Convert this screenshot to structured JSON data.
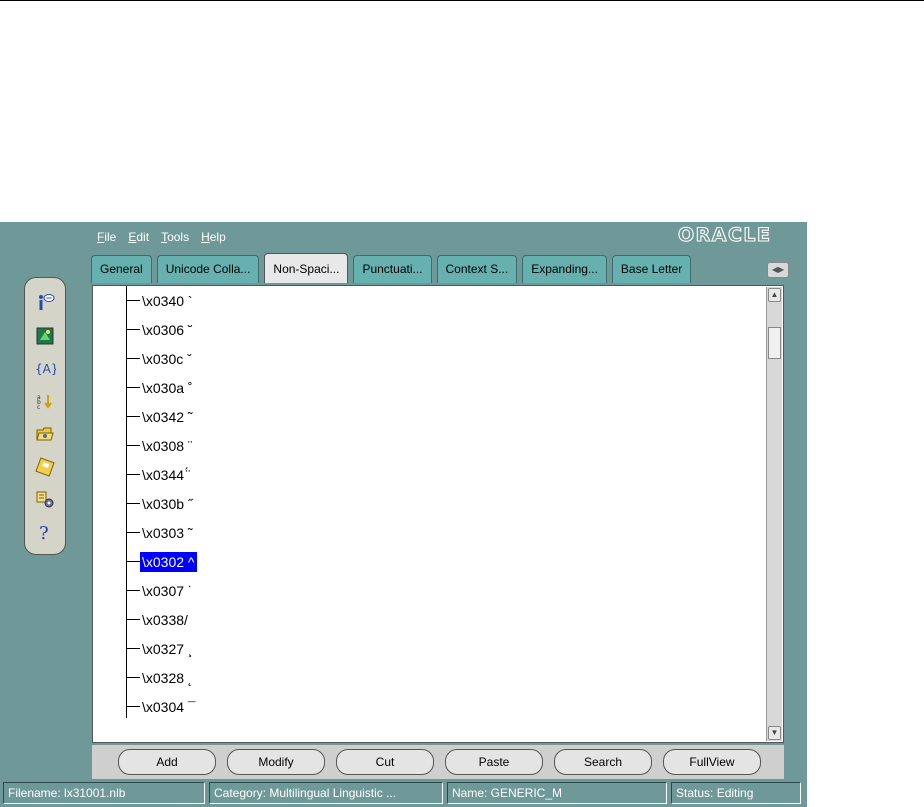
{
  "menu": {
    "file": {
      "accel": "F",
      "rest": "ile"
    },
    "edit": {
      "accel": "E",
      "rest": "dit"
    },
    "tools": {
      "accel": "T",
      "rest": "ools"
    },
    "help": {
      "accel": "H",
      "rest": "elp"
    }
  },
  "brand": "ORACLE",
  "tabs": [
    {
      "label": "General"
    },
    {
      "label": "Unicode Colla..."
    },
    {
      "label": "Non-Spaci..."
    },
    {
      "label": "Punctuati..."
    },
    {
      "label": "Context S..."
    },
    {
      "label": "Expanding..."
    },
    {
      "label": "Base Letter"
    }
  ],
  "active_tab": "Non-Spaci...",
  "toolbar_icons": [
    "info-icon",
    "image-icon",
    "variable-icon",
    "sort-icon",
    "open-icon",
    "save-icon",
    "properties-icon",
    "help-icon"
  ],
  "tree": {
    "items": [
      {
        "label": "\\x0340 `"
      },
      {
        "label": "\\x0306 ˘"
      },
      {
        "label": "\\x030c ˇ"
      },
      {
        "label": "\\x030a ˚"
      },
      {
        "label": "\\x0342 ˜"
      },
      {
        "label": "\\x0308 ¨"
      },
      {
        "label": "\\x0344 ̈́"
      },
      {
        "label": "\\x030b ˝"
      },
      {
        "label": "\\x0303 ˜"
      },
      {
        "label": "\\x0302 ^"
      },
      {
        "label": "\\x0307 ˙"
      },
      {
        "label": "\\x0338/"
      },
      {
        "label": "\\x0327 ¸"
      },
      {
        "label": "\\x0328 ˛"
      },
      {
        "label": "\\x0304 ¯"
      }
    ],
    "selected_index": 9
  },
  "buttons": {
    "add": "Add",
    "modify": "Modify",
    "cut": "Cut",
    "paste": "Paste",
    "search": "Search",
    "fullview": "FullView"
  },
  "status": {
    "filename": "Filename: lx31001.nlb",
    "category": "Category: Multilingual Linguistic ...",
    "name": "Name: GENERIC_M",
    "state": "Status: Editing"
  },
  "colors": {
    "app_background": "#6f9898",
    "tab": "#66b0b0",
    "selection": "#0000ff"
  }
}
